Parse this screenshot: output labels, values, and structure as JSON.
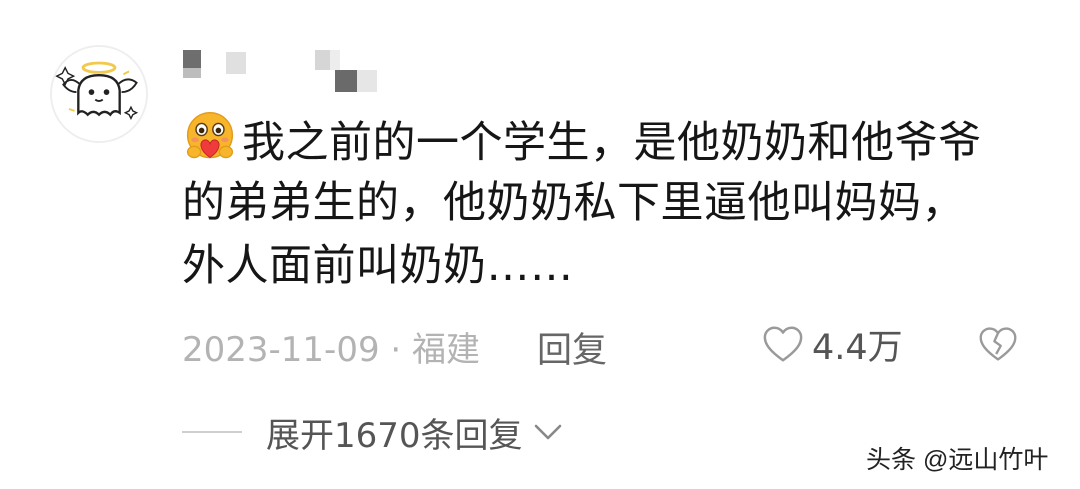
{
  "comment": {
    "lines": [
      "我之前的一个学生，是他奶奶和他爷爷",
      "的弟弟生的，他奶奶私下里逼他叫妈妈，",
      "外人面前叫奶奶……"
    ],
    "emoji": "hugging-face-with-heart"
  },
  "meta": {
    "date_location": "2023-11-09 · 福建",
    "reply_label": "回复",
    "like_count": "4.4万"
  },
  "expand_label": "展开1670条回复",
  "watermark": "头条 @远山竹叶",
  "colors": {
    "text": "#161616",
    "meta": "#b3b3b3",
    "secondary": "#555555",
    "emoji_face": "#f7b52c",
    "heart": "#ef3b3b"
  }
}
